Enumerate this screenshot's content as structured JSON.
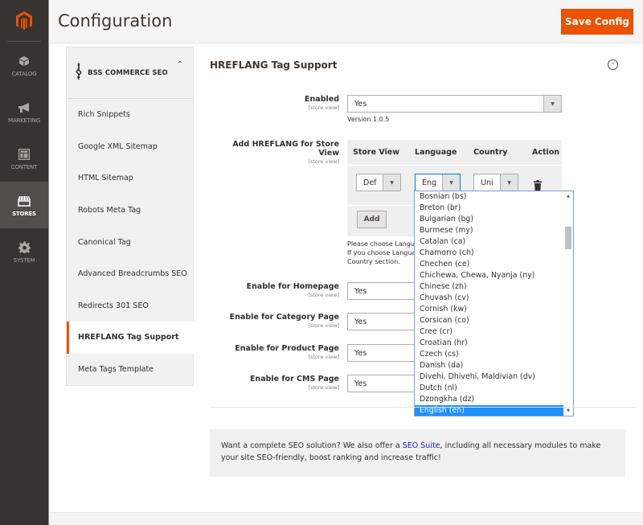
{
  "admin_nav": {
    "logo": "magento-logo",
    "items": [
      {
        "label": "CATALOG",
        "icon": "box-icon",
        "active": false
      },
      {
        "label": "MARKETING",
        "icon": "megaphone-icon",
        "active": false
      },
      {
        "label": "CONTENT",
        "icon": "layout-icon",
        "active": false
      },
      {
        "label": "STORES",
        "icon": "storefront-icon",
        "active": true
      },
      {
        "label": "SYSTEM",
        "icon": "gear-icon",
        "active": false
      }
    ]
  },
  "header": {
    "title": "Configuration",
    "save_label": "Save Config",
    "accent": "#eb5202"
  },
  "tabs": {
    "brand": "BSS COMMERCE SEO",
    "items": [
      {
        "label": "Rich Snippets",
        "active": false
      },
      {
        "label": "Google XML Sitemap",
        "active": false
      },
      {
        "label": "HTML Sitemap",
        "active": false
      },
      {
        "label": "Robots Meta Tag",
        "active": false
      },
      {
        "label": "Canonical Tag",
        "active": false
      },
      {
        "label": "Advanced Breadcrumbs SEO",
        "active": false
      },
      {
        "label": "Redirects 301 SEO",
        "active": false
      },
      {
        "label": "HREFLANG Tag Support",
        "active": true
      },
      {
        "label": "Meta Tags Template",
        "active": false
      }
    ]
  },
  "section": {
    "title": "HREFLANG Tag Support",
    "scope": "[store view]",
    "enabled": {
      "label": "Enabled",
      "value": "Yes",
      "note": "Version 1.0.5"
    },
    "hreflang": {
      "label": "Add HREFLANG for Store View",
      "columns": [
        "Store View",
        "Language",
        "Country",
        "Action"
      ],
      "row": {
        "store_view": "Def",
        "language": "Eng",
        "country": "Uni"
      },
      "add_label": "Add",
      "help_lines": [
        "Please choose Langua",
        "If you choose Langua",
        "Country section."
      ]
    },
    "homepage": {
      "label": "Enable for Homepage",
      "value": "Yes"
    },
    "category": {
      "label": "Enable for Category Page",
      "value": "Yes"
    },
    "product": {
      "label": "Enable for Product Page",
      "value": "Yes"
    },
    "cms": {
      "label": "Enable for CMS Page",
      "value": "Yes"
    }
  },
  "language_dropdown": {
    "options": [
      "Bosnian (bs)",
      "Breton (br)",
      "Bulgarian (bg)",
      "Burmese (my)",
      "Catalan (ca)",
      "Chamorro (ch)",
      "Chechen (ce)",
      "Chichewa, Chewa, Nyanja (ny)",
      "Chinese (zh)",
      "Chuvash (cv)",
      "Cornish (kw)",
      "Corsican (co)",
      "Cree (cr)",
      "Croatian (hr)",
      "Czech (cs)",
      "Danish (da)",
      "Divehi, Dhivehi, Maldivian (dv)",
      "Dutch (nl)",
      "Dzongkha (dz)",
      "English (en)"
    ],
    "selected": "English (en)",
    "selected_color": "#1e90ff"
  },
  "promo": {
    "before": "Want a complete SEO solution? We also offer a ",
    "link": "SEO Suite",
    "after": ", including all necessary modules to make your site SEO-friendly, boost ranking and increase traffic!",
    "link_color": "#1a1adb"
  }
}
